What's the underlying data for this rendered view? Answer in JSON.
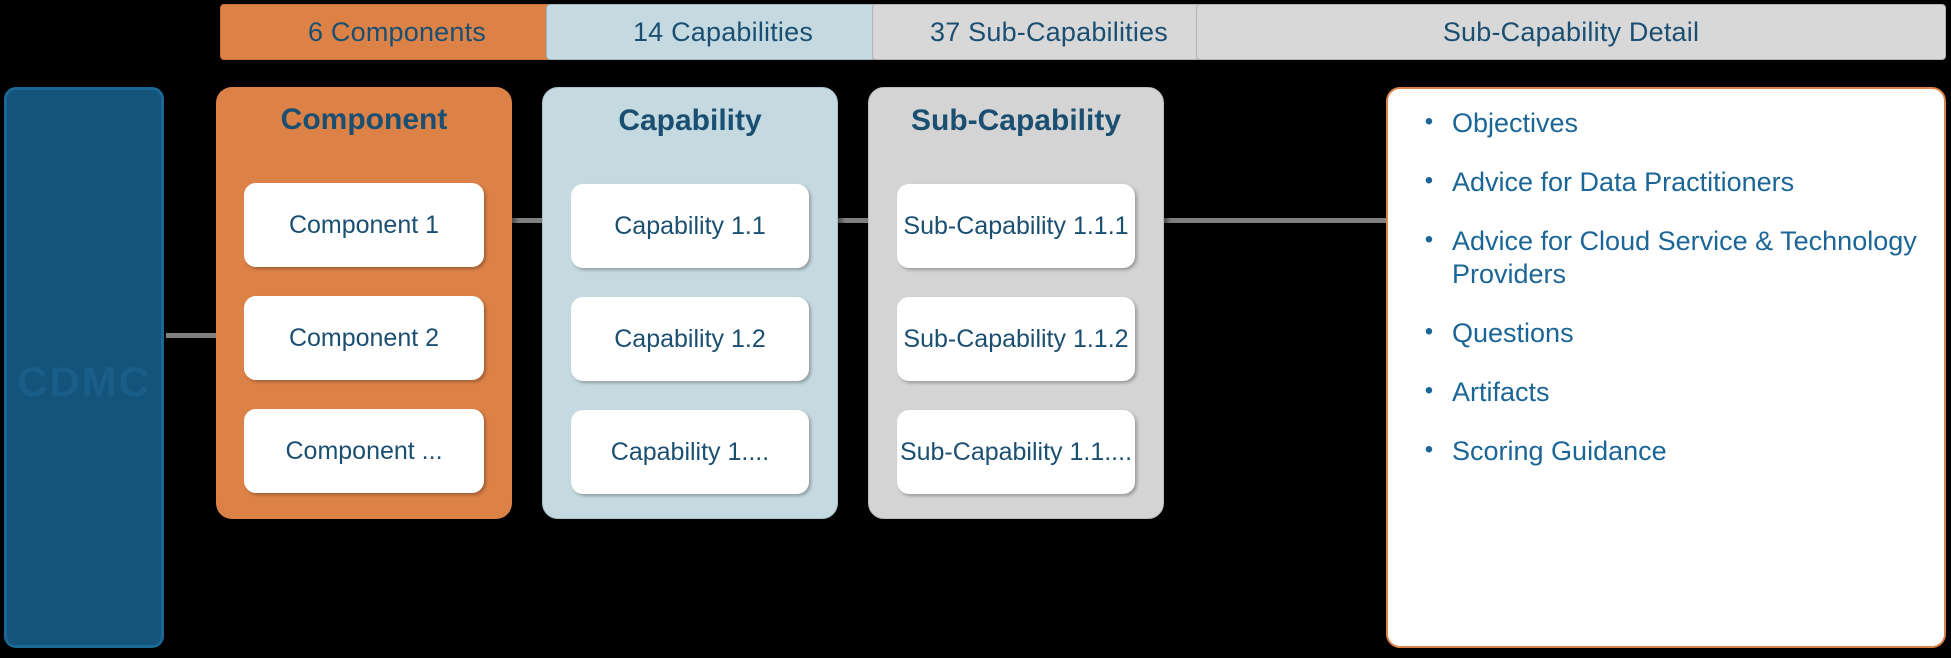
{
  "header_bars": [
    {
      "label": "6 Components",
      "style": "orange"
    },
    {
      "label": "14 Capabilities",
      "style": "blue"
    },
    {
      "label": "37 Sub-Capabilities",
      "style": "gray"
    },
    {
      "label": "Sub-Capability  Detail",
      "style": "gray"
    }
  ],
  "root_panel": {
    "watermark": "CDMC"
  },
  "columns": [
    {
      "title": "Component",
      "nodes": [
        "Component 1",
        "Component 2",
        "Component ..."
      ]
    },
    {
      "title": "Capability",
      "nodes": [
        "Capability 1.1",
        "Capability 1.2",
        "Capability 1...."
      ]
    },
    {
      "title": "Sub-Capability",
      "nodes": [
        "Sub-Capability 1.1.1",
        "Sub-Capability 1.1.2",
        "Sub-Capability 1.1...."
      ]
    }
  ],
  "detail_panel": {
    "bullet_glyph": "•",
    "items": [
      "Objectives",
      "Advice for Data Practitioners",
      "Advice for Cloud Service & Technology Providers",
      "Questions",
      "Artifacts",
      "Scoring Guidance"
    ]
  },
  "colors": {
    "component_orange": "#dd8247",
    "capability_blue": "#c5dae0",
    "subcapability_gray": "#d4d4d4",
    "root_navy": "#14537a",
    "text_navy": "#1b4f72",
    "link_blue": "#1b6696",
    "connector_gray": "#808080",
    "background": "#000000"
  }
}
